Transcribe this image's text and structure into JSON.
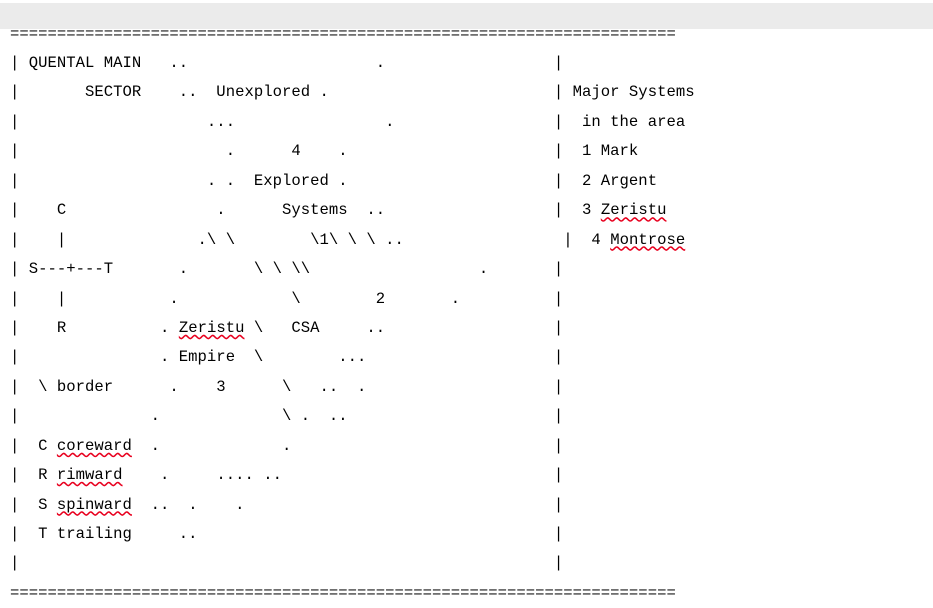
{
  "document": {
    "kind": "ascii-star-map",
    "title_text": "QUENTAL MAIN",
    "subtitle_text": "SECTOR",
    "border_char": "=",
    "border_width_chars": 71,
    "frame_char": "|",
    "text_color": "#000000",
    "background_color": "#ffffff",
    "header_band_color": "#ebebeb",
    "spellcheck_underline_color": "#e8001e"
  },
  "map": {
    "region_labels": [
      "QUENTAL MAIN",
      "SECTOR",
      "Unexplored",
      "Explored",
      "Systems",
      "Zeristu",
      "Empire",
      "CSA"
    ],
    "numbered_markers": [
      "1",
      "2",
      "3",
      "4"
    ],
    "compass_glyph_row": "S---+---T",
    "compass_top": "C",
    "compass_bottom": "R"
  },
  "legend": {
    "border_entry": {
      "symbol": "\\",
      "label": "border"
    },
    "directions": [
      {
        "symbol": "C",
        "label": "coreward",
        "misspelled": true
      },
      {
        "symbol": "R",
        "label": "rimward",
        "misspelled": true
      },
      {
        "symbol": "S",
        "label": "spinward",
        "misspelled": true
      },
      {
        "symbol": "T",
        "label": "trailing",
        "misspelled": false
      }
    ]
  },
  "sidebar": {
    "heading_line_1": "Major Systems",
    "heading_line_2": "in the area",
    "systems": [
      {
        "number": "1",
        "name": "Mark",
        "misspelled": false
      },
      {
        "number": "2",
        "name": "Argent",
        "misspelled": false
      },
      {
        "number": "3",
        "name": "Zeristu",
        "misspelled": true
      },
      {
        "number": "4",
        "name": "Montrose",
        "misspelled": true
      }
    ]
  },
  "ascii": {
    "top_rule": "=======================================================================",
    "bottom_rule": "=======================================================================",
    "line_01_left": "| QUENTAL MAIN   ..                    .                             |",
    "line_02_left": "|       SECTOR    ..  Unexplored .                                    |",
    "line_03_left": "|                    ...                .                            |",
    "line_04_left": "|                      .      4    .                                  |",
    "line_05_left": "|                    . .  Explored .                                  |",
    "line_06_left": "|    C                .       Systems  ..                            |",
    "line_07_left": "|    |              .\\ \\         \\1\\ \\ \\ ..                          |",
    "line_08_left": "| S---+---T       .      \\ \\ \\\\                     .                 |",
    "line_09_left": "|    |           .            \\        2        .                     |",
    "line_10_left": "|    R          . Zeristu \\   CSA     ..                             |",
    "line_11_left": "|               . Empire  \\        ...                               |",
    "line_12_left": "|  \\ border      .    3      \\   ..  .                               |",
    "line_13_left": "|              .             \\ .  ..                                  |",
    "line_14_left": "|  C coreward  .             .                                        |",
    "line_15_left": "|  R rimward    .     .... ..                                         |",
    "line_16_left": "|  S spinward  ..  .    .                                             |",
    "line_17_left": "|  T trailing     ..                                                  |",
    "line_18_left": "|                                                                     |"
  },
  "rows": [
    {
      "id": "r1",
      "map": "| QUENTAL MAIN   ..                    .                  |",
      "side_plain": ""
    },
    {
      "id": "r2",
      "map": "|       SECTOR    ..  Unexplored .                        |",
      "side_plain": " Major Systems"
    },
    {
      "id": "r3",
      "map": "|                    ...                .                 |",
      "side_plain": "  in the area"
    },
    {
      "id": "r4",
      "map": "|                      .      4    .                      |",
      "side_plain": "  1 Mark"
    },
    {
      "id": "r5",
      "map": "|                    . .  Explored .                      |",
      "side_plain": "  2 Argent"
    },
    {
      "id": "r6",
      "map": "|    C                .      Systems  ..                  |",
      "side_plain": "  3 Zeristu"
    },
    {
      "id": "r7",
      "map": "|    |              .\\ \\        \\1\\ \\ \\ ..                 |",
      "side_plain": "  4 Montrose"
    },
    {
      "id": "r8",
      "map": "| S---+---T       .       \\ \\ \\\\                  .       |",
      "side_plain": ""
    },
    {
      "id": "r9",
      "map": "|    |           .            \\        2       .          |",
      "side_plain": ""
    },
    {
      "id": "r10",
      "map": "|    R          . Zeristu \\   CSA     ..                  |",
      "side_plain": ""
    },
    {
      "id": "r11",
      "map": "|               . Empire  \\        ...                    |",
      "side_plain": ""
    },
    {
      "id": "r12",
      "map": "|  \\ border      .    3      \\   ..  .                    |",
      "side_plain": ""
    },
    {
      "id": "r13",
      "map": "|              .             \\ .  ..                      |",
      "side_plain": ""
    },
    {
      "id": "r14",
      "map": "|  C coreward  .             .                            |",
      "side_plain": ""
    },
    {
      "id": "r15",
      "map": "|  R rimward    .     .... ..                             |",
      "side_plain": ""
    },
    {
      "id": "r16",
      "map": "|  S spinward  ..  .    .                                 |",
      "side_plain": ""
    },
    {
      "id": "r17",
      "map": "|  T trailing     ..                                      |",
      "side_plain": ""
    },
    {
      "id": "r18",
      "map": "|                                                         |",
      "side_plain": ""
    }
  ],
  "segments": {
    "row1": {
      "a": "| QUENTAL MAIN   ..                    .                  |"
    },
    "row2": {
      "a": "|       SECTOR    ..  Unexplored .                        | Major Systems"
    },
    "row3": {
      "a": "|                    ...                .                 |  in the area"
    },
    "row4": {
      "a": "|                      .      4    .                      |  1 Mark"
    },
    "row5": {
      "a": "|                    . .  Explored .                      |  2 Argent"
    },
    "row6": {
      "a": "|    C                .      Systems  ..                  |  3 ",
      "b": "Zeristu"
    },
    "row7": {
      "a": "|    |              .\\ \\        \\1\\ \\ \\ ..                 |  4 ",
      "b": "Montrose"
    },
    "row8": {
      "a": "| S---+---T       .       \\ \\ \\\\                  .       |"
    },
    "row9": {
      "a": "|    |           .            \\        2       .          |"
    },
    "row10": {
      "a": "|    R          . ",
      "b": "Zeristu",
      "c": " \\   CSA     ..                  |"
    },
    "row11": {
      "a": "|               . Empire  \\        ...                    |"
    },
    "row12": {
      "a": "|  \\ border      .    3      \\   ..  .                    |"
    },
    "row13": {
      "a": "|              .             \\ .  ..                      |"
    },
    "row14": {
      "a": "|  C ",
      "b": "coreward",
      "c": "  .             .                            |"
    },
    "row15": {
      "a": "|  R ",
      "b": "rimward",
      "c": "    .     .... ..                             |"
    },
    "row16": {
      "a": "|  S ",
      "b": "spinward",
      "c": "  ..  .    .                                 |"
    },
    "row17": {
      "a": "|  T trailing     ..                                      |"
    },
    "row18": {
      "a": "|                                                         |"
    }
  }
}
